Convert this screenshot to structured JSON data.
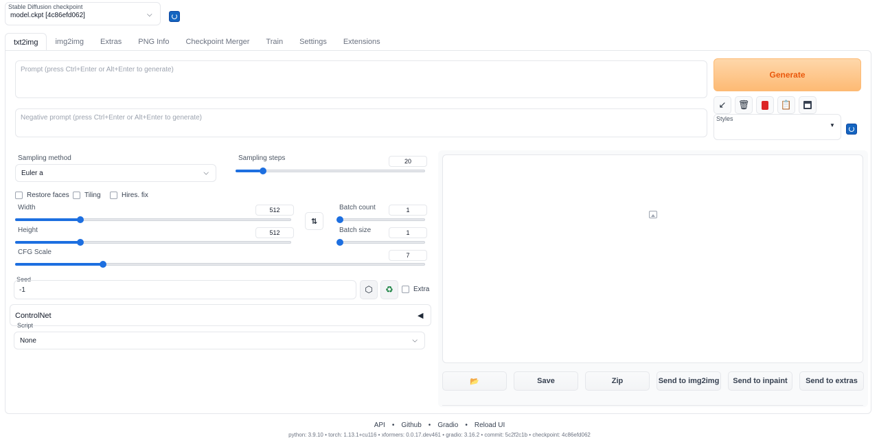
{
  "checkpoint": {
    "label": "Stable Diffusion checkpoint",
    "value": "model.ckpt [4c86efd062]"
  },
  "tabs": [
    {
      "label": "txt2img",
      "active": true
    },
    {
      "label": "img2img"
    },
    {
      "label": "Extras"
    },
    {
      "label": "PNG Info"
    },
    {
      "label": "Checkpoint Merger"
    },
    {
      "label": "Train"
    },
    {
      "label": "Settings"
    },
    {
      "label": "Extensions"
    }
  ],
  "prompt": {
    "placeholder": "Prompt (press Ctrl+Enter or Alt+Enter to generate)"
  },
  "negative_prompt": {
    "placeholder": "Negative prompt (press Ctrl+Enter or Alt+Enter to generate)"
  },
  "generate_label": "Generate",
  "tool_icons": [
    "arrow-icon",
    "trash-icon",
    "red-card-icon",
    "clipboard-icon",
    "save-icon"
  ],
  "styles": {
    "label": "Styles"
  },
  "sampling_method": {
    "label": "Sampling method",
    "value": "Euler a"
  },
  "sampling_steps": {
    "label": "Sampling steps",
    "value": "20",
    "fraction": 0.13
  },
  "checkboxes": {
    "restore_faces": "Restore faces",
    "tiling": "Tiling",
    "hires_fix": "Hires. fix"
  },
  "width": {
    "label": "Width",
    "value": "512",
    "fraction": 0.23
  },
  "height": {
    "label": "Height",
    "value": "512",
    "fraction": 0.23
  },
  "batch_count": {
    "label": "Batch count",
    "value": "1",
    "fraction": 0.0
  },
  "batch_size": {
    "label": "Batch size",
    "value": "1",
    "fraction": 0.0
  },
  "cfg_scale": {
    "label": "CFG Scale",
    "value": "7",
    "fraction": 0.21
  },
  "seed": {
    "label": "Seed",
    "value": "-1",
    "extra_label": "Extra"
  },
  "controlnet": {
    "label": "ControlNet",
    "arrow": "◀"
  },
  "script": {
    "label": "Script",
    "value": "None"
  },
  "output_buttons": {
    "save": "Save",
    "zip": "Zip",
    "send_img2img": "Send to img2img",
    "send_inpaint": "Send to inpaint",
    "send_extras": "Send to extras"
  },
  "footer": {
    "api": "API",
    "github": "Github",
    "gradio": "Gradio",
    "reload": "Reload UI",
    "sep": "•"
  },
  "versions": "python: 3.9.10  •  torch: 1.13.1+cu116  •  xformers: 0.0.17.dev461  •  gradio: 3.16.2  •  commit: 5c2f2c1b  •  checkpoint: 4c86efd062",
  "colors": {
    "accent": "#1d6fe0",
    "generate_bg": "#fdba74",
    "generate_text": "#ea580c",
    "refresh": "#1565c0"
  }
}
